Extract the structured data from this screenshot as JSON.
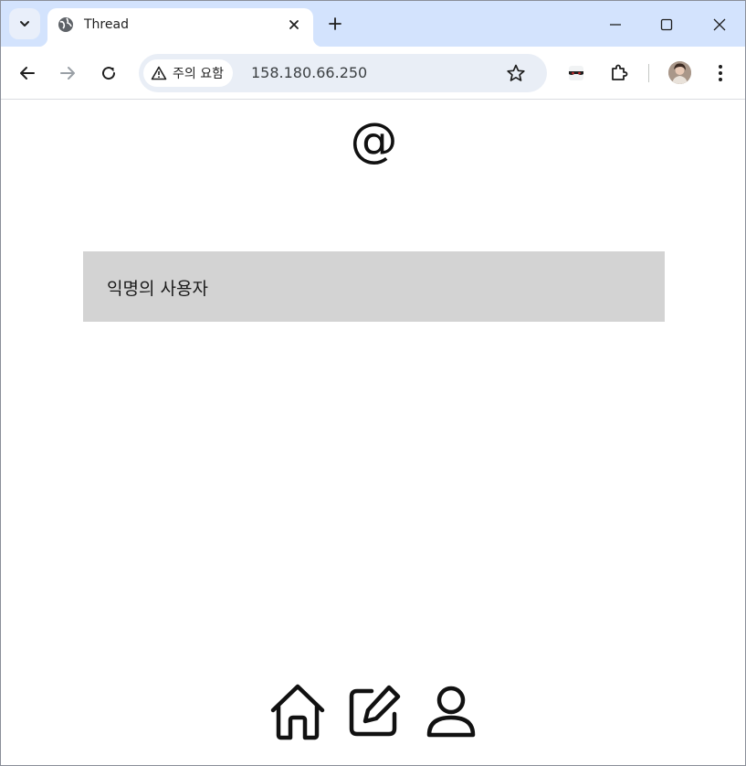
{
  "browser": {
    "tab": {
      "title": "Thread",
      "favicon": "globe-icon"
    },
    "omnibox": {
      "security_label": "주의 요함",
      "url": "158.180.66.250"
    },
    "colors": {
      "tabstrip": "#d3e3fd",
      "omnibox": "#e9eef6"
    }
  },
  "page": {
    "logo": "@",
    "user_card": {
      "name": "익명의 사용자",
      "background": "#d3d3d3"
    },
    "bottom_nav": [
      {
        "icon": "home-icon"
      },
      {
        "icon": "edit-icon"
      },
      {
        "icon": "user-icon"
      }
    ]
  }
}
